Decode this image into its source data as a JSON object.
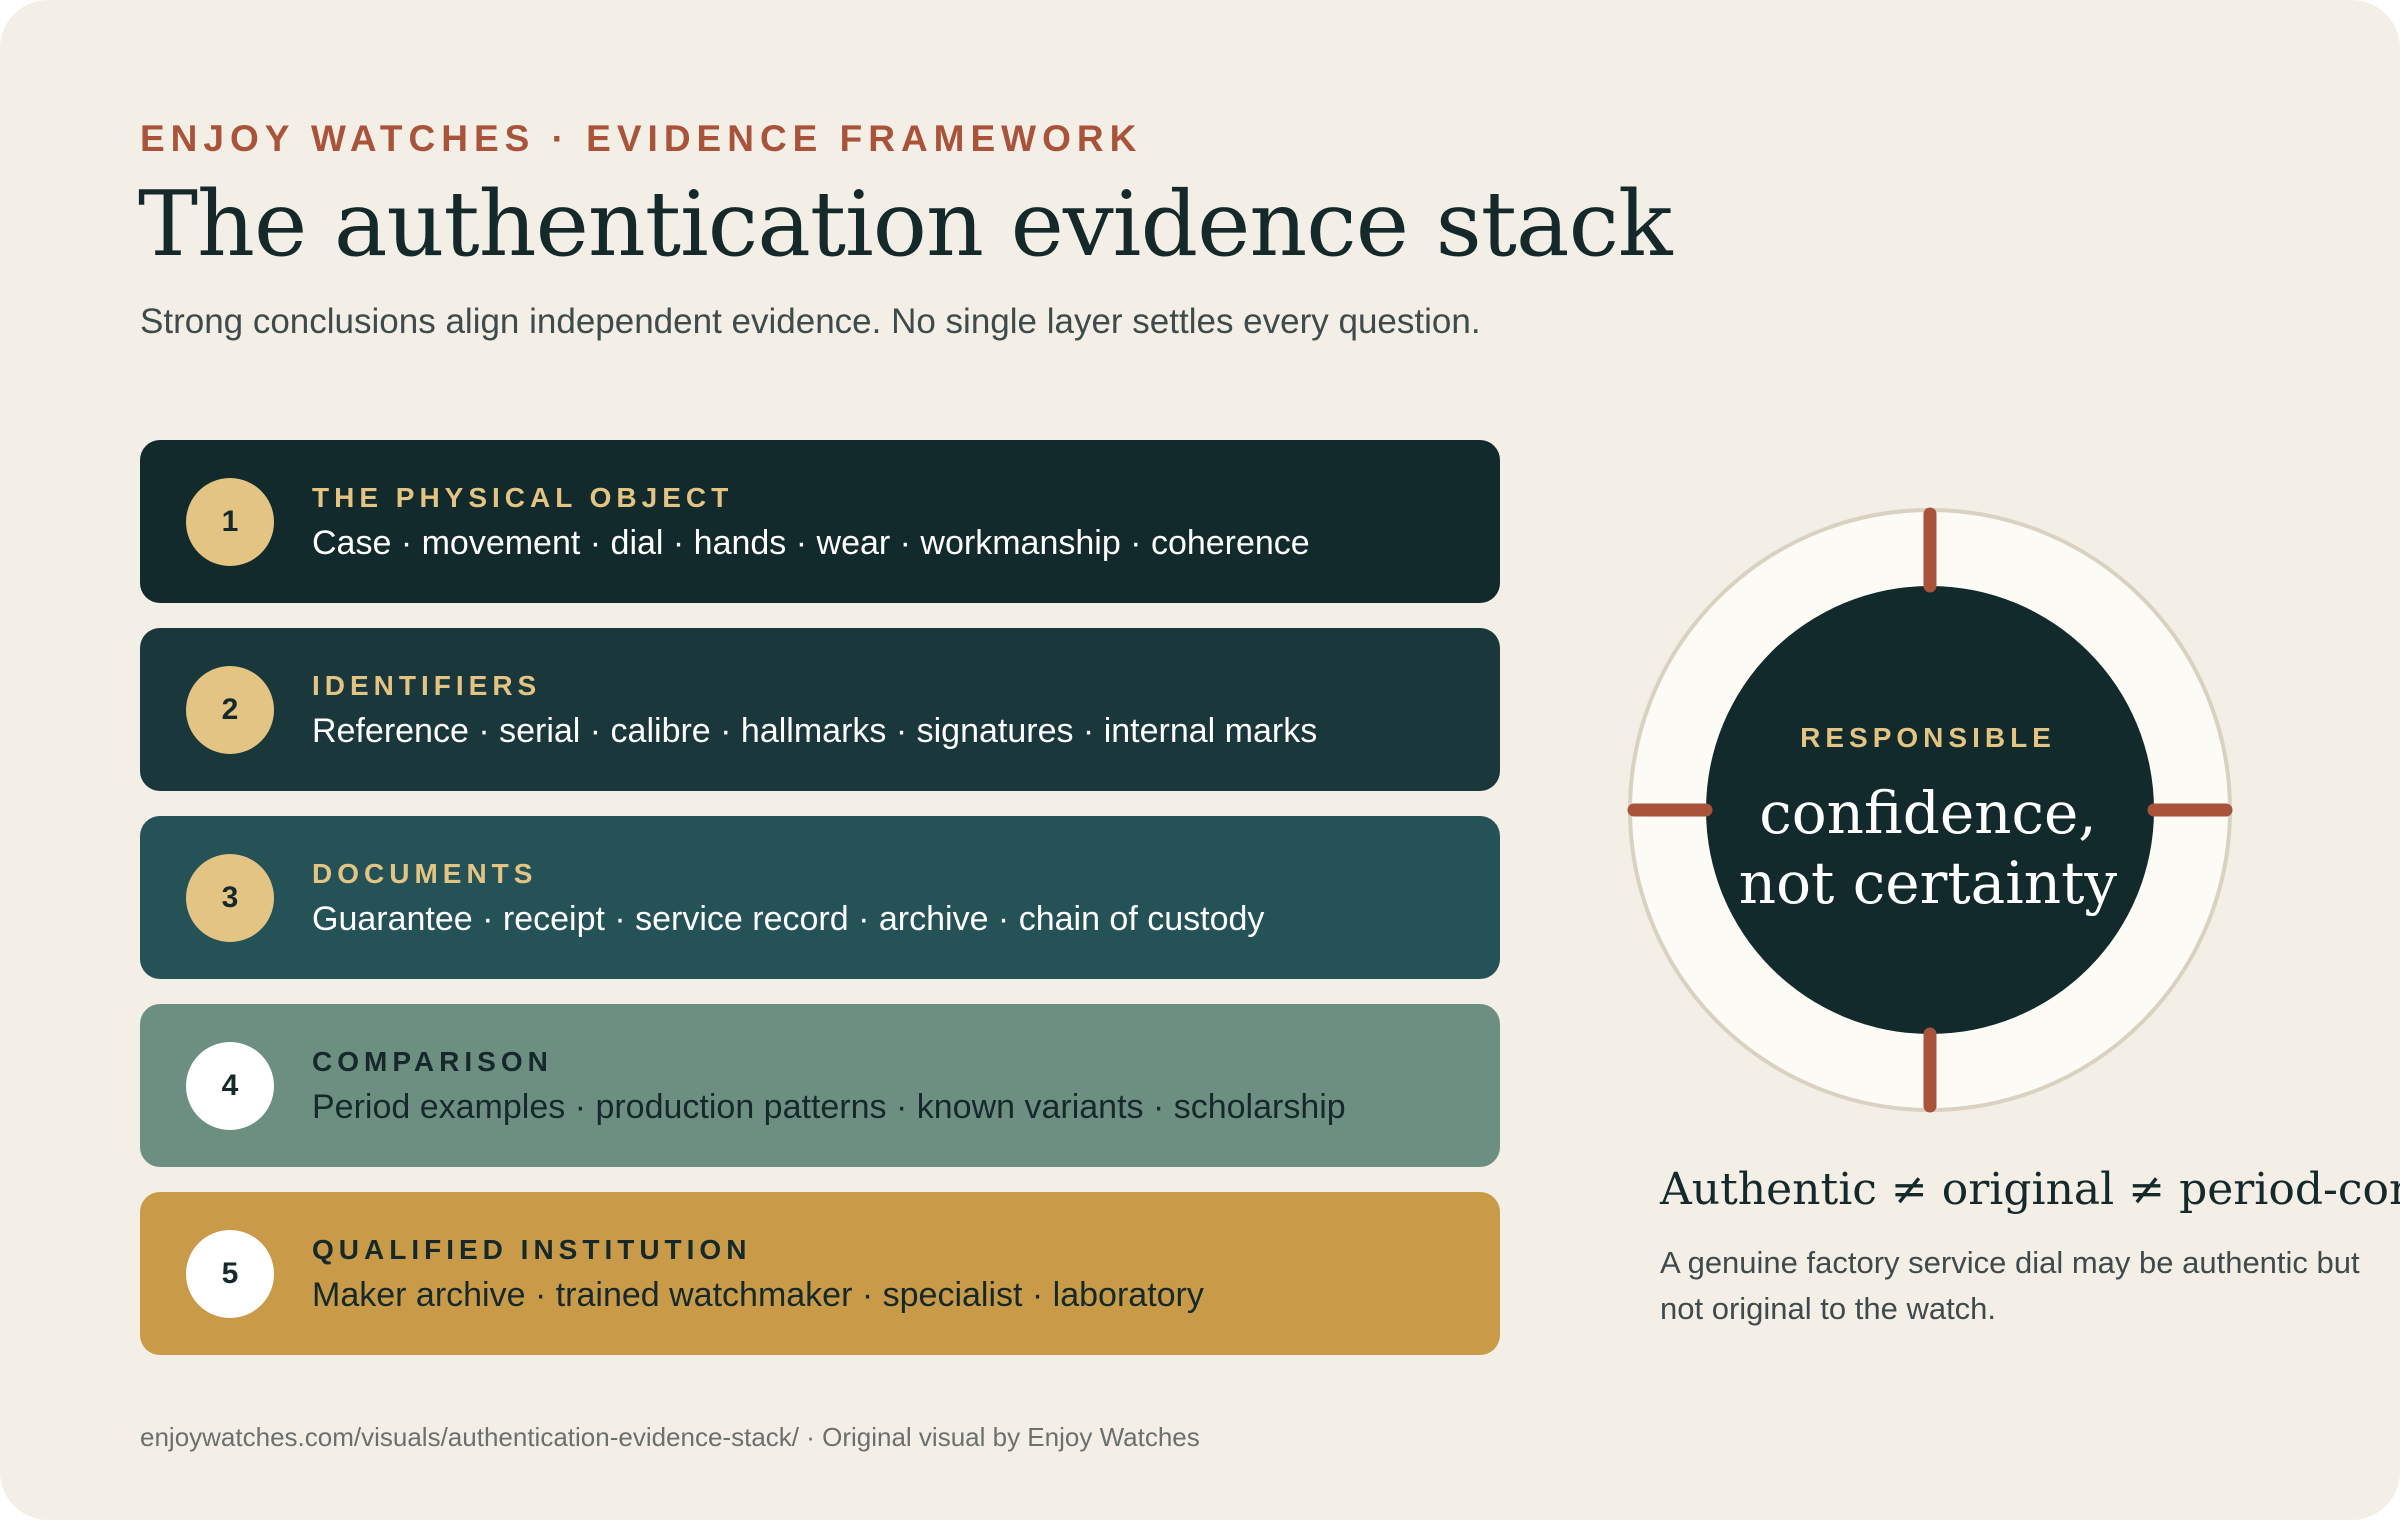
{
  "header": {
    "eyebrow": "ENJOY WATCHES · EVIDENCE FRAMEWORK",
    "title": "The authentication evidence stack",
    "subtitle": "Strong conclusions align independent evidence. No single layer settles every question."
  },
  "layers": [
    {
      "number": "1",
      "label": "THE PHYSICAL OBJECT",
      "items": "Case · movement · dial · hands · wear · workmanship · coherence",
      "bg": "#132a2c",
      "badge": "#e3c483",
      "label_color": "#e3c483",
      "text_color": "#ffffff"
    },
    {
      "number": "2",
      "label": "IDENTIFIERS",
      "items": "Reference · serial · calibre · hallmarks · signatures · internal marks",
      "bg": "#1a383b",
      "badge": "#e3c483",
      "label_color": "#e3c483",
      "text_color": "#ffffff"
    },
    {
      "number": "3",
      "label": "DOCUMENTS",
      "items": "Guarantee · receipt · service record · archive · chain of custody",
      "bg": "#245257",
      "badge": "#e3c483",
      "label_color": "#e3c483",
      "text_color": "#ffffff"
    },
    {
      "number": "4",
      "label": "COMPARISON",
      "items": "Period examples · production patterns · known variants · scholarship",
      "bg": "#6d8f82",
      "badge": "#ffffff",
      "label_color": "#15292b",
      "text_color": "#15292b"
    },
    {
      "number": "5",
      "label": "QUALIFIED INSTITUTION",
      "items": "Maker archive · trained watchmaker · specialist · laboratory",
      "bg": "#c99a48",
      "badge": "#ffffff",
      "label_color": "#15292b",
      "text_color": "#15292b"
    }
  ],
  "dial": {
    "label": "RESPONSIBLE",
    "line1": "confidence,",
    "line2": "not certainty"
  },
  "side": {
    "formula": "Authentic ≠ original ≠ period-correct",
    "note": "A genuine factory service dial may be authentic but not original to the watch."
  },
  "footer": "enjoywatches.com/visuals/authentication-evidence-stack/ · Original visual by Enjoy Watches",
  "colors": {
    "background": "#f3efe6",
    "accent": "#a9533a",
    "ink": "#15292b",
    "gold": "#e3c483"
  }
}
